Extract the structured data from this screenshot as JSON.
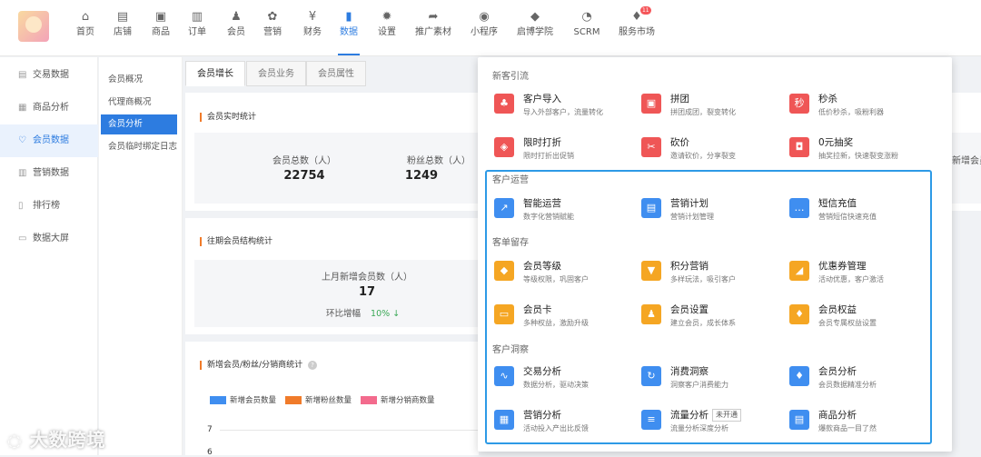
{
  "top_nav": [
    {
      "label": "首页",
      "icon": "home-icon",
      "glyph": "⌂"
    },
    {
      "label": "店铺",
      "icon": "store-icon",
      "glyph": "▤"
    },
    {
      "label": "商品",
      "icon": "goods-icon",
      "glyph": "▣"
    },
    {
      "label": "订单",
      "icon": "order-icon",
      "glyph": "▥"
    },
    {
      "label": "会员",
      "icon": "member-icon",
      "glyph": "♟"
    },
    {
      "label": "营销",
      "icon": "marketing-icon",
      "glyph": "✿"
    },
    {
      "label": "财务",
      "icon": "finance-icon",
      "glyph": "¥"
    },
    {
      "label": "数据",
      "icon": "data-icon",
      "glyph": "▮"
    },
    {
      "label": "设置",
      "icon": "settings-icon",
      "glyph": "✹"
    },
    {
      "label": "推广素材",
      "icon": "share-icon",
      "glyph": "➦"
    },
    {
      "label": "小程序",
      "icon": "miniapp-icon",
      "glyph": "◉"
    },
    {
      "label": "启博学院",
      "icon": "academy-icon",
      "glyph": "◆"
    },
    {
      "label": "SCRM",
      "icon": "scrm-icon",
      "glyph": "◔"
    },
    {
      "label": "服务市场",
      "icon": "market-icon",
      "glyph": "♦",
      "badge": "11"
    }
  ],
  "sidebar": [
    {
      "label": "交易数据",
      "icon": "trade-icon",
      "glyph": "▤"
    },
    {
      "label": "商品分析",
      "icon": "goods-analysis-icon",
      "glyph": "▦"
    },
    {
      "label": "会员数据",
      "icon": "member-data-icon",
      "glyph": "♡"
    },
    {
      "label": "营销数据",
      "icon": "marketing-data-icon",
      "glyph": "▥"
    },
    {
      "label": "排行榜",
      "icon": "rank-icon",
      "glyph": "▯"
    },
    {
      "label": "数据大屏",
      "icon": "screen-icon",
      "glyph": "▭"
    }
  ],
  "subnav": [
    "会员概况",
    "代理商概况",
    "会员分析",
    "会员临时绑定日志"
  ],
  "tabs": [
    "会员增长",
    "会员业务",
    "会员属性"
  ],
  "realtime": {
    "title": "会员实时统计",
    "total_label": "会员总数（人）",
    "total_value": "22754",
    "fans_label": "粉丝总数（人）",
    "fans_value": "1249",
    "cut_label": "新增会员"
  },
  "history": {
    "title": "往期会员结构统计",
    "new_label": "上月新增会员数（人）",
    "new_value": "17",
    "ring_label": "环比增幅",
    "ring_value": "10%",
    "ring_arrow": "↓"
  },
  "trend": {
    "title": "新增会员/粉丝/分销商统计",
    "help": "?",
    "legend": [
      {
        "label": "新增会员数量",
        "color": "#3f8ef0"
      },
      {
        "label": "新增粉丝数量",
        "color": "#f07b2a"
      },
      {
        "label": "新增分销商数量",
        "color": "#f36b8d"
      }
    ],
    "y_ticks": [
      "7",
      "6"
    ]
  },
  "dropdown": {
    "groups": [
      {
        "title": "新客引流",
        "items": [
          {
            "title": "客户导入",
            "desc": "导入外部客户，流量转化",
            "icon": "customer-import-icon",
            "glyph": "♣",
            "color": "#ef5656"
          },
          {
            "title": "拼团",
            "desc": "拼团成团，裂变转化",
            "icon": "group-buy-icon",
            "glyph": "▣",
            "color": "#ef5656"
          },
          {
            "title": "秒杀",
            "desc": "低价秒杀，吸粉利器",
            "icon": "flash-sale-icon",
            "glyph": "秒",
            "color": "#ef5656"
          },
          {
            "title": "限时打折",
            "desc": "限时打折出促销",
            "icon": "discount-icon",
            "glyph": "◈",
            "color": "#ef5656"
          },
          {
            "title": "砍价",
            "desc": "邀请砍价，分享裂变",
            "icon": "bargain-icon",
            "glyph": "✂",
            "color": "#ef5656"
          },
          {
            "title": "0元抽奖",
            "desc": "抽奖拉新，快速裂变涨粉",
            "icon": "lottery-icon",
            "glyph": "◘",
            "color": "#ef5656"
          }
        ]
      },
      {
        "title": "客户运营",
        "items": [
          {
            "title": "智能运营",
            "desc": "数字化营销赋能",
            "icon": "smart-ops-icon",
            "glyph": "↗",
            "color": "#3f8ef0"
          },
          {
            "title": "营销计划",
            "desc": "营销计划管理",
            "icon": "plan-icon",
            "glyph": "▤",
            "color": "#3f8ef0"
          },
          {
            "title": "短信充值",
            "desc": "营销短信快速充值",
            "icon": "sms-icon",
            "glyph": "…",
            "color": "#3f8ef0"
          }
        ]
      },
      {
        "title": "客单留存",
        "items": [
          {
            "title": "会员等级",
            "desc": "等级权限，巩固客户",
            "icon": "member-level-icon",
            "glyph": "◆",
            "color": "#f5a623"
          },
          {
            "title": "积分营销",
            "desc": "多样玩法，吸引客户",
            "icon": "points-icon",
            "glyph": "▼",
            "color": "#f5a623"
          },
          {
            "title": "优惠券管理",
            "desc": "活动优惠，客户激活",
            "icon": "coupon-icon",
            "glyph": "◢",
            "color": "#f5a623"
          },
          {
            "title": "会员卡",
            "desc": "多种权益，激励升级",
            "icon": "member-card-icon",
            "glyph": "▭",
            "color": "#f5a623"
          },
          {
            "title": "会员设置",
            "desc": "建立会员，成长体系",
            "icon": "member-settings-icon",
            "glyph": "♟",
            "color": "#f5a623"
          },
          {
            "title": "会员权益",
            "desc": "会员专属权益设置",
            "icon": "member-rights-icon",
            "glyph": "♦",
            "color": "#f5a623"
          }
        ]
      },
      {
        "title": "客户洞察",
        "items": [
          {
            "title": "交易分析",
            "desc": "数据分析，驱动决策",
            "icon": "trade-analysis-icon",
            "glyph": "∿",
            "color": "#3f8ef0"
          },
          {
            "title": "消费洞察",
            "desc": "洞察客户消费能力",
            "icon": "consumption-icon",
            "glyph": "↻",
            "color": "#3f8ef0"
          },
          {
            "title": "会员分析",
            "desc": "会员数据精准分析",
            "icon": "member-analysis-icon",
            "glyph": "♦",
            "color": "#3f8ef0"
          },
          {
            "title": "营销分析",
            "desc": "活动投入产出比反馈",
            "icon": "marketing-analysis-icon",
            "glyph": "▦",
            "color": "#3f8ef0"
          },
          {
            "title": "流量分析",
            "desc": "流量分析深度分析",
            "icon": "traffic-icon",
            "glyph": "≡",
            "color": "#3f8ef0",
            "tag": "未开通"
          },
          {
            "title": "商品分析",
            "desc": "爆款商品一目了然",
            "icon": "product-analysis-icon",
            "glyph": "▤",
            "color": "#3f8ef0"
          }
        ]
      }
    ]
  },
  "watermark": "大数跨境"
}
